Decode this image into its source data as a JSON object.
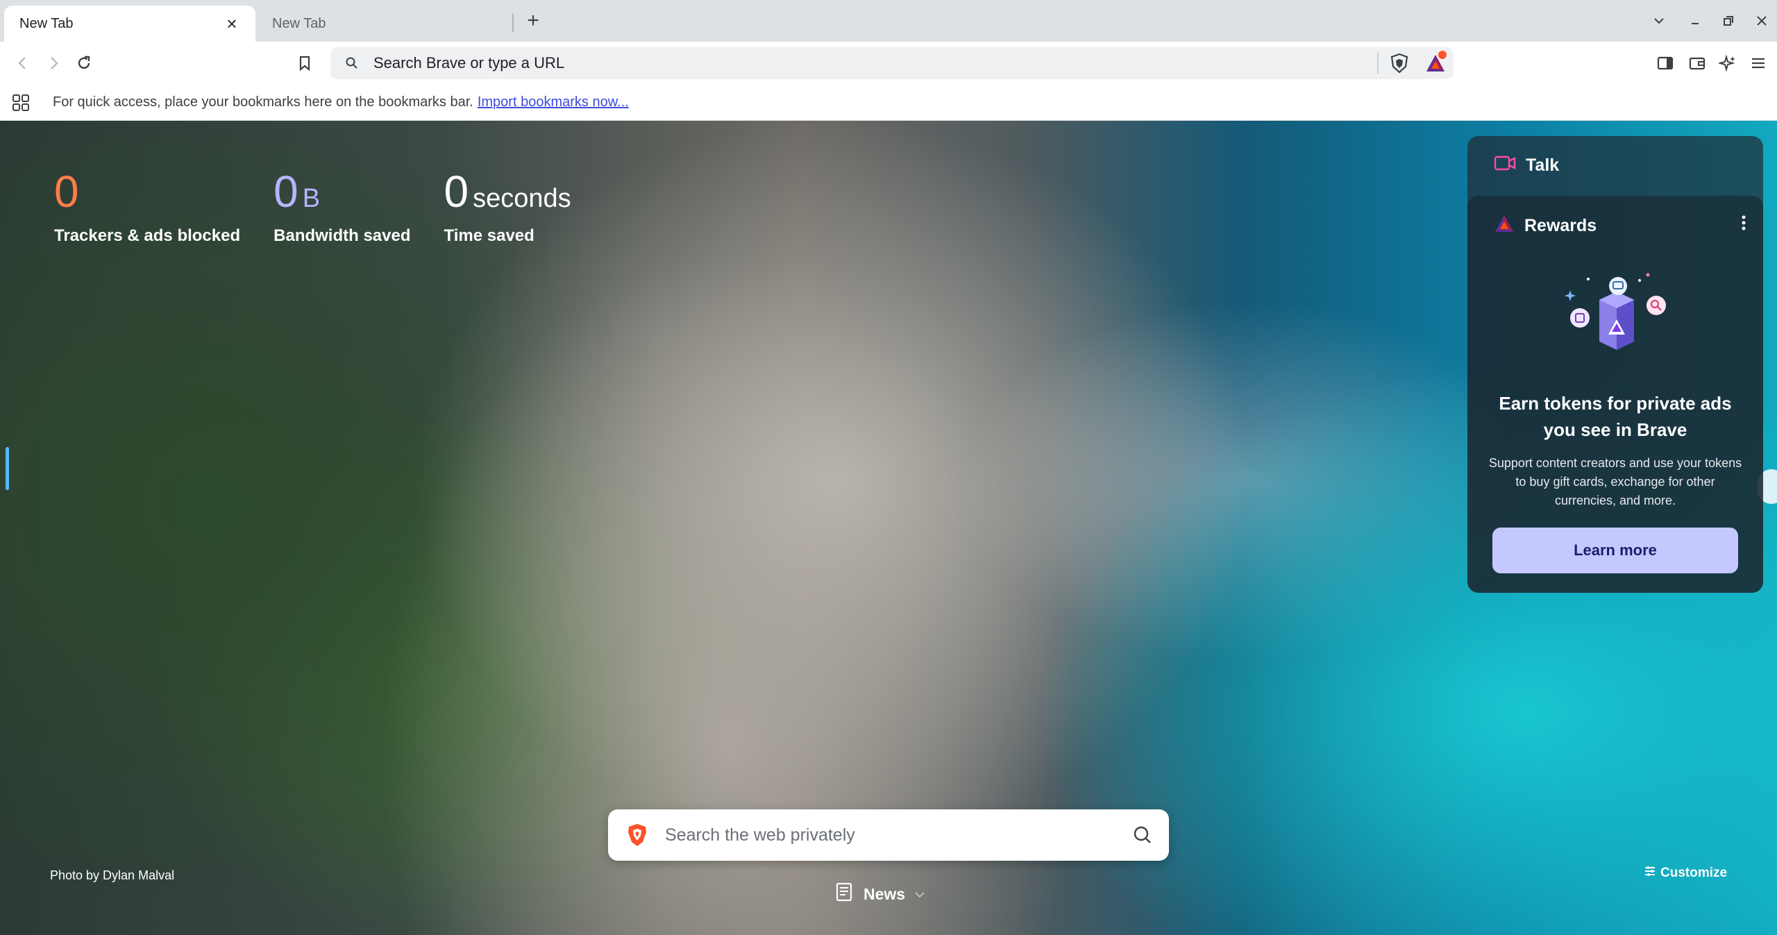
{
  "tabs": [
    {
      "title": "New Tab",
      "active": true,
      "close": "×"
    },
    {
      "title": "New Tab",
      "active": false
    }
  ],
  "new_tab_symbol": "+",
  "omnibox": {
    "placeholder": "Search Brave or type a URL"
  },
  "bookmarks_bar": {
    "message": "For quick access, place your bookmarks here on the bookmarks bar.",
    "import_link": "Import bookmarks now..."
  },
  "stats": [
    {
      "value": "0",
      "unit": "",
      "label": "Trackers & ads blocked",
      "color": "#ff7c4a"
    },
    {
      "value": "0",
      "unit": "B",
      "label": "Bandwidth saved",
      "color": "#b7b4ff"
    },
    {
      "value": "0",
      "unit": "seconds",
      "label": "Time saved",
      "color": "#ffffff"
    }
  ],
  "photo_credit": "Photo by Dylan Malval",
  "customize_label": "Customize",
  "search": {
    "placeholder": "Search the web privately"
  },
  "news_label": "News",
  "widgets": {
    "talk_label": "Talk",
    "rewards_label": "Rewards",
    "earn_title": "Earn tokens for private ads you see in Brave",
    "earn_desc": "Support content creators and use your tokens to buy gift cards, exchange for other currencies, and more.",
    "learn_more": "Learn more"
  },
  "colors": {
    "brand_orange": "#fb542b",
    "rewards_button": "#c5c8ff",
    "talk_icon": "#ff4da6"
  },
  "icons": [
    "close-icon",
    "plus-icon",
    "chevron-down-icon",
    "minimize-icon",
    "restore-icon",
    "window-close-icon",
    "back-icon",
    "forward-icon",
    "reload-icon",
    "bookmark-icon",
    "search-icon",
    "brave-shield-icon",
    "bat-rewards-icon",
    "sidebar-icon",
    "wallet-icon",
    "leo-ai-icon",
    "menu-icon",
    "apps-grid-icon",
    "magnifier-icon",
    "news-icon",
    "customize-icon",
    "talk-icon",
    "rewards-icon",
    "kebab-menu-icon"
  ]
}
